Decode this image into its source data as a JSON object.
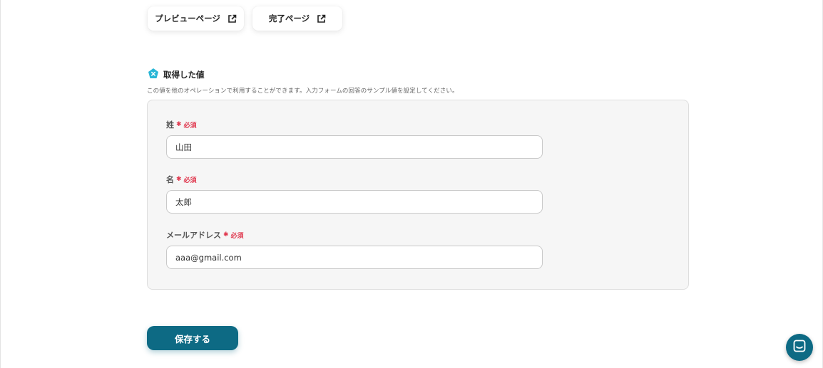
{
  "top_links": {
    "preview_label": "プレビューページ",
    "complete_label": "完了ページ"
  },
  "section": {
    "title": "取得した値",
    "description": "この値を他のオペレーションで利用することができます。入力フォームの回答のサンプル値を設定してください。"
  },
  "fields": [
    {
      "label": "姓",
      "required_label": "必須",
      "value": "山田"
    },
    {
      "label": "名",
      "required_label": "必須",
      "value": "太郎"
    },
    {
      "label": "メールアドレス",
      "required_label": "必須",
      "value": "aaa@gmail.com"
    }
  ],
  "save_button": {
    "label": "保存する"
  },
  "icons": {
    "external_link": "external-link-icon",
    "section": "pentagon-x-icon",
    "asterisk": "asterisk-icon",
    "chat": "chat-icon"
  },
  "colors": {
    "accent": "#0d6a84",
    "required": "#e0394f",
    "section_icon": "#29b6d6"
  }
}
